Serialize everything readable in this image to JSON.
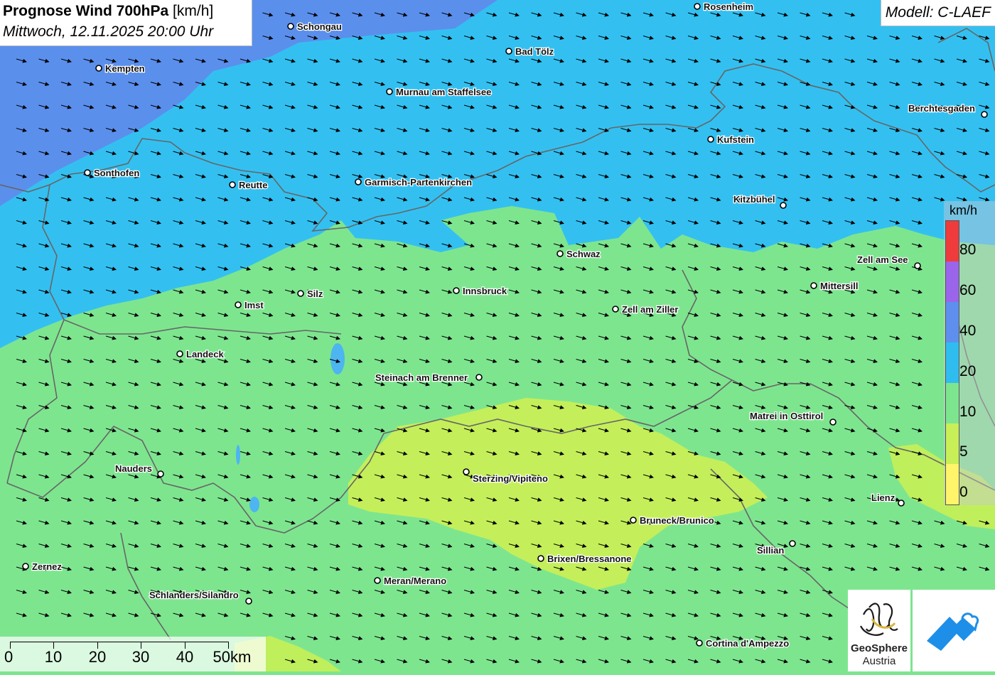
{
  "title": {
    "bold": "Prognose Wind 700hPa",
    "unit": "[km/h]",
    "datetime": "Mittwoch, 12.11.2025 20:00 Uhr"
  },
  "model": "Modell: C-LAEF",
  "legend": {
    "unit": "km/h",
    "levels": [
      {
        "label": "80",
        "color": "#ef3b3b"
      },
      {
        "label": "60",
        "color": "#9a65ea"
      },
      {
        "label": "40",
        "color": "#5f8fee"
      },
      {
        "label": "20",
        "color": "#2fbdf0"
      },
      {
        "label": "10",
        "color": "#7ee58f"
      },
      {
        "label": "5",
        "color": "#c8ef57"
      },
      {
        "label": "0",
        "color": "#fff46a"
      }
    ]
  },
  "scalebar": {
    "labels": [
      "0",
      "10",
      "20",
      "30",
      "40",
      "50km"
    ]
  },
  "cities": [
    {
      "name": "Rosenheim"
    },
    {
      "name": "Schongau"
    },
    {
      "name": "Bad Tölz"
    },
    {
      "name": "Kempten"
    },
    {
      "name": "Murnau am Staffelsee"
    },
    {
      "name": "Berchtesgaden"
    },
    {
      "name": "Kufstein"
    },
    {
      "name": "Sonthofen"
    },
    {
      "name": "Reutte"
    },
    {
      "name": "Garmisch-Partenkirchen"
    },
    {
      "name": "Kitzbühel"
    },
    {
      "name": "Schwaz"
    },
    {
      "name": "Zell am See"
    },
    {
      "name": "Mittersill"
    },
    {
      "name": "Silz"
    },
    {
      "name": "Innsbruck"
    },
    {
      "name": "Imst"
    },
    {
      "name": "Zell am Ziller"
    },
    {
      "name": "Landeck"
    },
    {
      "name": "Steinach am Brenner"
    },
    {
      "name": "Matrei in Osttirol"
    },
    {
      "name": "Nauders"
    },
    {
      "name": "Sterzing/Vipiteno"
    },
    {
      "name": "Lienz"
    },
    {
      "name": "Bruneck/Brunico"
    },
    {
      "name": "Sillian"
    },
    {
      "name": "Brixen/Bressanone"
    },
    {
      "name": "Zernez"
    },
    {
      "name": "Meran/Merano"
    },
    {
      "name": "Schlanders/Silandro"
    },
    {
      "name": "Cortina d'Ampezzo"
    }
  ],
  "logos": {
    "geosphere_line1": "GeoSphere",
    "geosphere_line2": "Austria"
  },
  "wind": {
    "direction": "west-northwest to east-southeast",
    "arrow_icon": "wind-arrow-icon"
  }
}
